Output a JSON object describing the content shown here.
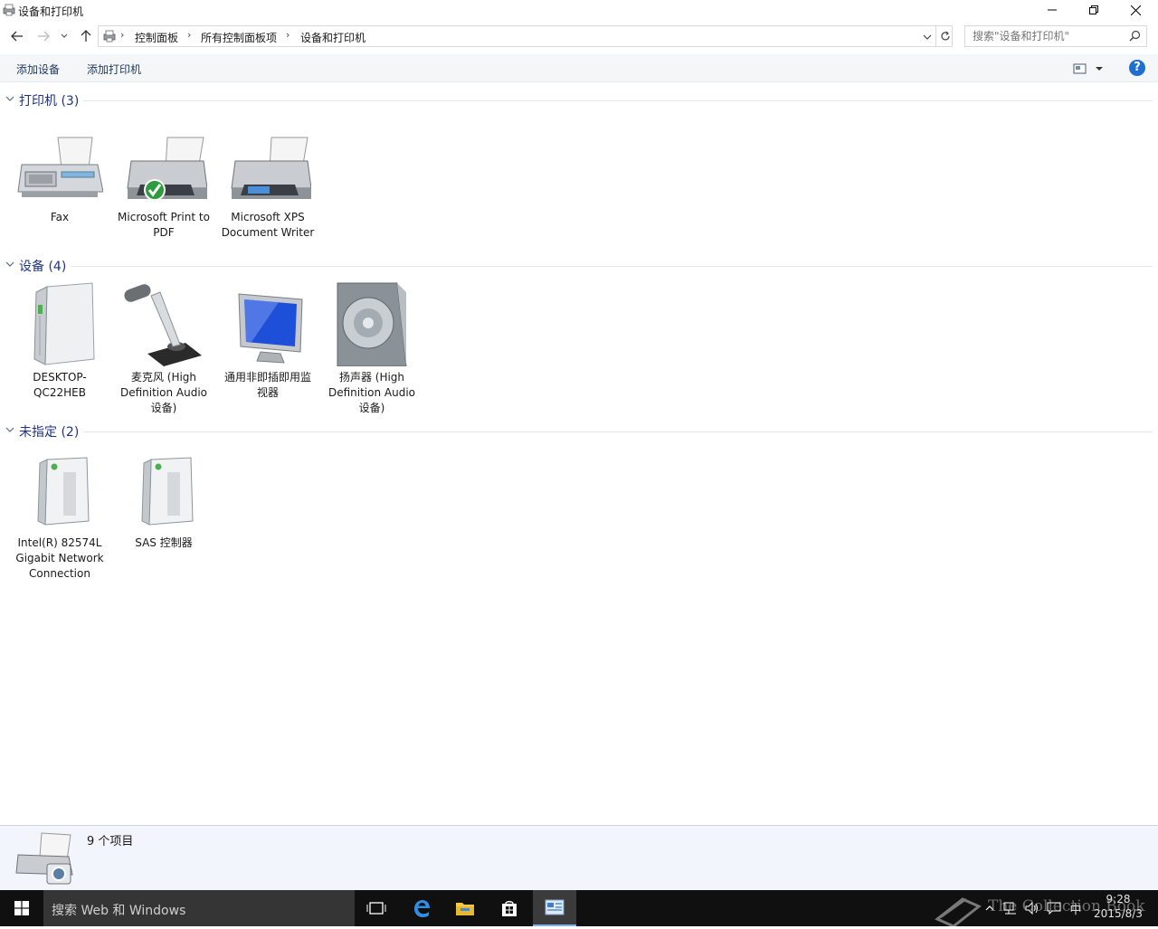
{
  "window": {
    "title": "设备和打印机",
    "controls": {
      "minimize": "minimize-icon",
      "maximize": "restore-icon",
      "close": "close-icon"
    }
  },
  "address": {
    "breadcrumbs": [
      "控制面板",
      "所有控制面板项",
      "设备和打印机"
    ],
    "search_placeholder": "搜索\"设备和打印机\""
  },
  "toolbar": {
    "add_device": "添加设备",
    "add_printer": "添加打印机",
    "help": "?"
  },
  "groups": [
    {
      "title": "打印机 (3)",
      "items": [
        {
          "label": "Fax",
          "icon": "fax-icon"
        },
        {
          "label": "Microsoft Print to PDF",
          "icon": "printer-default-icon"
        },
        {
          "label": "Microsoft XPS Document Writer",
          "icon": "printer-icon"
        }
      ]
    },
    {
      "title": "设备 (4)",
      "items": [
        {
          "label": "DESKTOP-QC22HEB",
          "icon": "computer-tower-icon"
        },
        {
          "label": "麦克风 (High Definition Audio 设备)",
          "icon": "microphone-icon"
        },
        {
          "label": "通用非即插即用监视器",
          "icon": "monitor-icon"
        },
        {
          "label": "扬声器 (High Definition Audio 设备)",
          "icon": "speaker-icon"
        }
      ]
    },
    {
      "title": "未指定 (2)",
      "items": [
        {
          "label": "Intel(R) 82574L Gigabit Network Connection",
          "icon": "generic-device-icon"
        },
        {
          "label": "SAS 控制器",
          "icon": "generic-device-icon"
        }
      ]
    }
  ],
  "details": {
    "count": "9 个项目"
  },
  "taskbar": {
    "search_placeholder": "搜索 Web 和 Windows",
    "ime": "中",
    "time": "9:28",
    "date": "2015/8/3"
  },
  "watermark": "The Collection Book",
  "colors": {
    "group_title": "#1e3287",
    "command": "#1e395b",
    "taskbar": "#101010",
    "details_bg": "#f2f5fb",
    "help": "#1f6fd0"
  }
}
